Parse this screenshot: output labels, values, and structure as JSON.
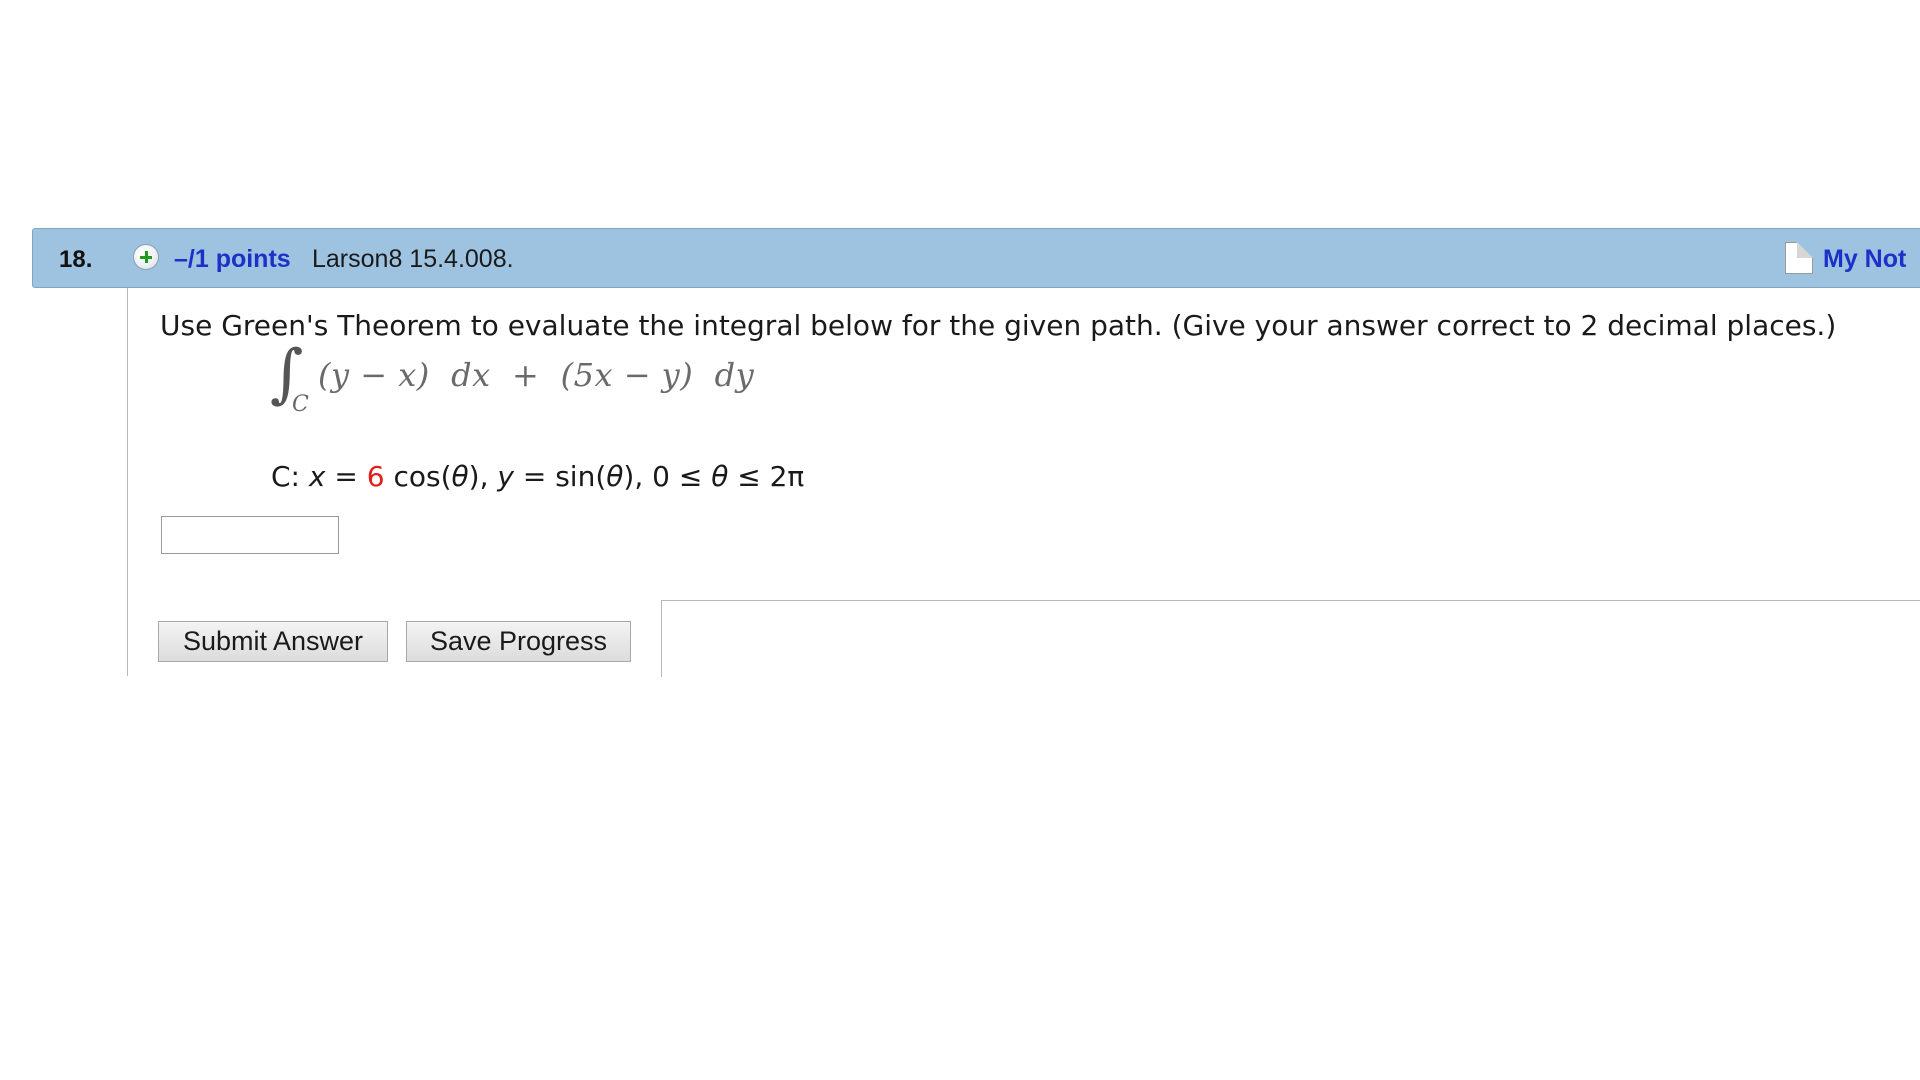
{
  "question": {
    "number": "18.",
    "points_label": "–/1 points",
    "source": "Larson8 15.4.008.",
    "notes_label": "My Not",
    "prompt": "Use Green's Theorem to evaluate the integral below for the given path. (Give your answer correct to 2 decimal places.)",
    "integral": {
      "sign": "∫",
      "subscript": "C",
      "expression": "(y − x)  dx  +  (5x − y)  dy"
    },
    "path": {
      "prefix": "C: ",
      "x_var": "x",
      "x_eq": " = ",
      "x_coef": "6",
      "x_rest": " cos(",
      "theta1": "θ",
      "x_close": "), ",
      "y_var": "y",
      "y_eq": " = sin(",
      "theta2": "θ",
      "y_close": "), 0 ≤ ",
      "theta3": "θ",
      "range_end": " ≤ 2π"
    },
    "answer_value": ""
  },
  "buttons": {
    "submit_label": "Submit Answer",
    "save_label": "Save Progress"
  },
  "colors": {
    "header_bar": "#9ec3e0",
    "link": "#1c31c8",
    "highlight_value": "#e0201c"
  }
}
